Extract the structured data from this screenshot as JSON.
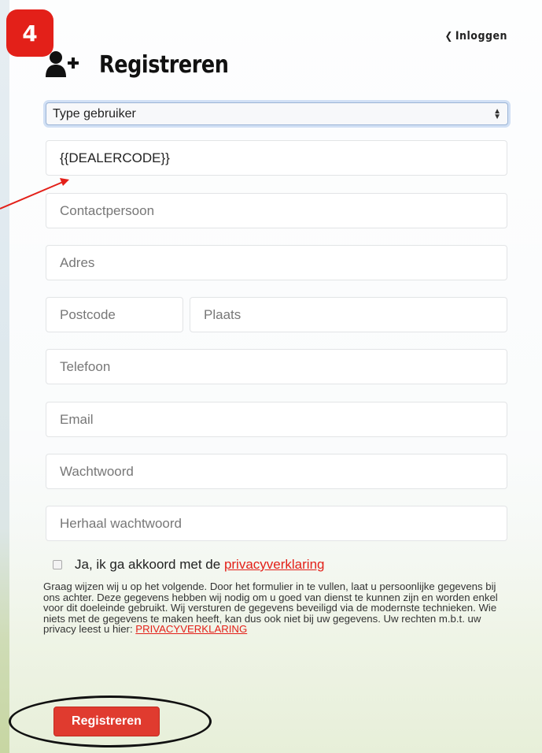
{
  "annotation": {
    "step_number": "4",
    "accent_color": "#e32019"
  },
  "header": {
    "login_link": "Inloggen",
    "title": "Registreren"
  },
  "form": {
    "user_type_select": {
      "selected": "Type gebruiker"
    },
    "fields": {
      "dealercode": {
        "value": "{{DEALERCODE}}"
      },
      "contactperson": {
        "placeholder": "Contactpersoon"
      },
      "address": {
        "placeholder": "Adres"
      },
      "postcode": {
        "placeholder": "Postcode"
      },
      "city": {
        "placeholder": "Plaats"
      },
      "phone": {
        "placeholder": "Telefoon"
      },
      "email": {
        "placeholder": "Email"
      },
      "password": {
        "placeholder": "Wachtwoord"
      },
      "password_repeat": {
        "placeholder": "Herhaal wachtwoord"
      }
    },
    "consent": {
      "checked": false,
      "label_prefix": "Ja, ik ga akkoord met de ",
      "link_text": "privacyverklaring"
    },
    "notice": {
      "text": "Graag wijzen wij u op het volgende. Door het formulier in te vullen, laat u persoonlijke gegevens bij ons achter. Deze gegevens hebben wij nodig om u goed van dienst te kunnen zijn en worden enkel voor dit doeleinde gebruikt. Wij versturen de gegevens beveiligd via de modernste technieken. Wie niets met de gegevens te maken heeft, kan dus ook niet bij uw gegevens. Uw rechten m.b.t. uw privacy leest u hier: ",
      "link_text": "PRIVACYVERKLARING"
    },
    "submit_label": "Registreren"
  }
}
